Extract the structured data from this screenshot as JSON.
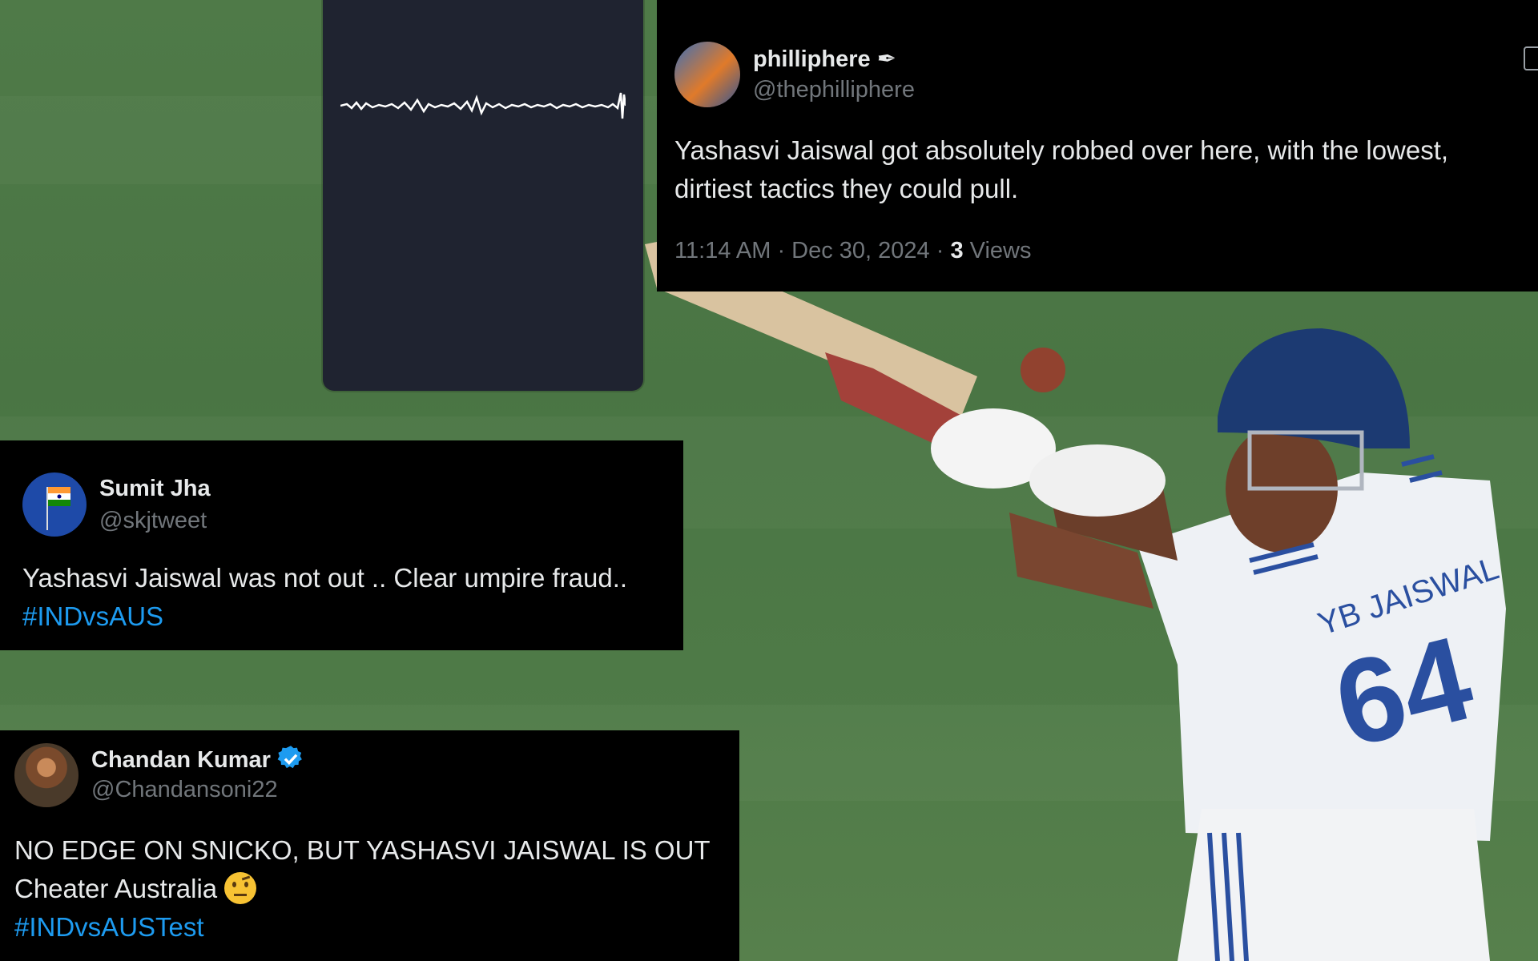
{
  "tweets": [
    {
      "name": "philliphere",
      "name_badge": "✒",
      "handle": "@thephilliphere",
      "lines": [
        "Yashasvi Jaiswal got absolutely robbed over here, with the lowest,",
        "dirtiest tactics they could pull."
      ],
      "time": "11:14 AM",
      "date": "Dec 30, 2024",
      "views_count": "3",
      "views_label": "Views"
    },
    {
      "name": "Sumit Jha",
      "handle": "@skjtweet",
      "lines": [
        "Yashasvi Jaiswal was not out .. Clear umpire fraud.."
      ],
      "hashtag": "#INDvsAUS"
    },
    {
      "name": "Chandan Kumar",
      "verified": true,
      "handle": "@Chandansoni22",
      "lines": [
        "NO EDGE ON SNICKO, BUT YASHASVI JAISWAL IS OUT"
      ],
      "line2_text": "Cheater Australia",
      "emoji": "🤨",
      "hashtag": "#INDvsAUSTest"
    }
  ],
  "jersey": {
    "name": "YB JAISWAL",
    "number": "64"
  },
  "icons": [
    "snicko-waveform",
    "flag-avatar",
    "verified-badge-icon",
    "raised-eyebrow-emoji"
  ],
  "colors": {
    "tweet_bg": "#000000",
    "text": "#e7e9ea",
    "muted": "#71767b",
    "link": "#1d9bf0",
    "verified": "#1d9bf0",
    "grass": "#4f7a48",
    "helmet": "#1c3a72"
  }
}
